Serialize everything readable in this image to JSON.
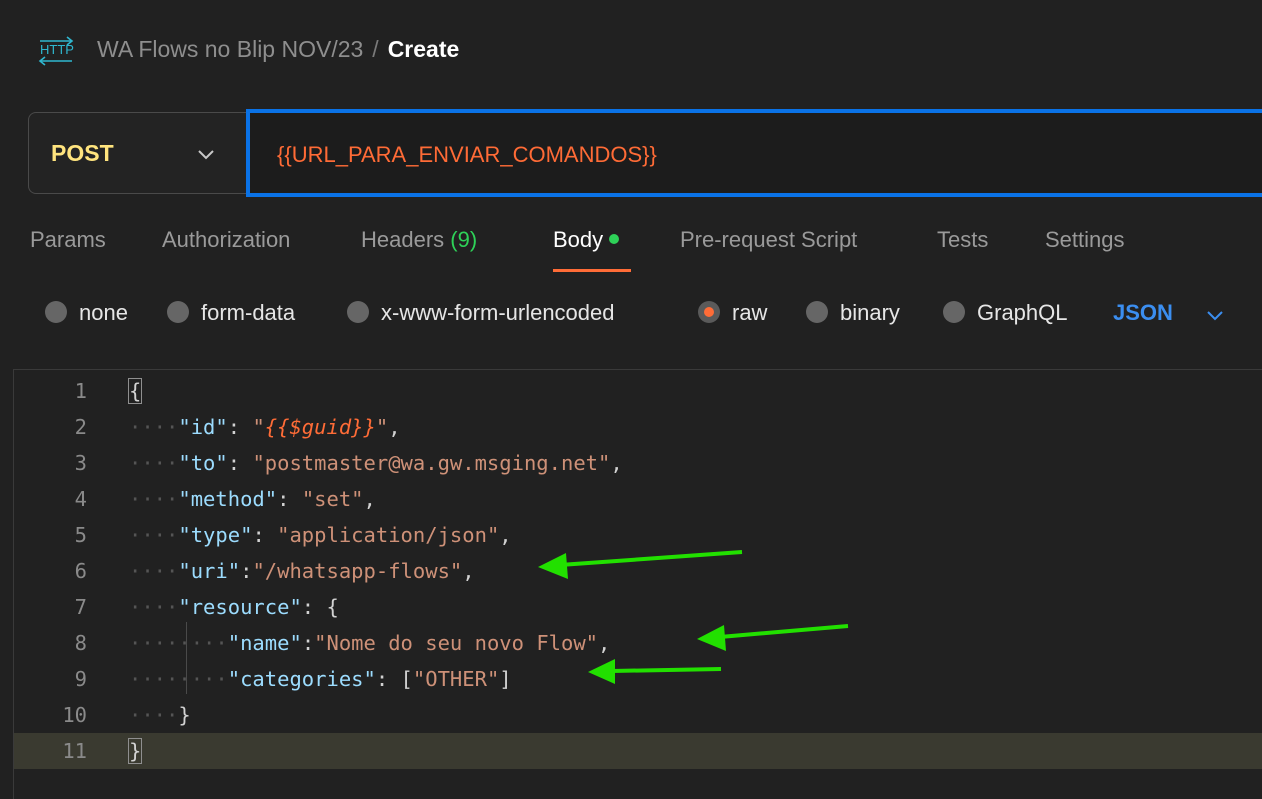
{
  "header": {
    "icon": "http-icon",
    "breadcrumb_parent": "WA Flows no Blip NOV/23",
    "breadcrumb_separator": "/",
    "breadcrumb_current": "Create"
  },
  "request": {
    "method": "POST",
    "url": "{{URL_PARA_ENVIAR_COMANDOS}}"
  },
  "tabs": [
    {
      "label": "Params"
    },
    {
      "label": "Authorization"
    },
    {
      "label": "Headers",
      "count": "(9)"
    },
    {
      "label": "Body",
      "active": true
    },
    {
      "label": "Pre-request Script"
    },
    {
      "label": "Tests"
    },
    {
      "label": "Settings"
    }
  ],
  "body_types": {
    "options": [
      "none",
      "form-data",
      "x-www-form-urlencoded",
      "raw",
      "binary",
      "GraphQL"
    ],
    "selected": "raw",
    "format": "JSON"
  },
  "editor": {
    "line_numbers": [
      "1",
      "2",
      "3",
      "4",
      "5",
      "6",
      "7",
      "8",
      "9",
      "10",
      "11"
    ],
    "lines": [
      {
        "indent": "",
        "tokens": [
          {
            "t": "{",
            "c": "punct"
          }
        ]
      },
      {
        "indent": "····",
        "tokens": [
          {
            "t": "\"id\"",
            "c": "key"
          },
          {
            "t": ": ",
            "c": "punct"
          },
          {
            "t": "\"",
            "c": "str"
          },
          {
            "t": "{{$guid}}",
            "c": "var"
          },
          {
            "t": "\"",
            "c": "str"
          },
          {
            "t": ",",
            "c": "punct"
          }
        ]
      },
      {
        "indent": "····",
        "tokens": [
          {
            "t": "\"to\"",
            "c": "key"
          },
          {
            "t": ": ",
            "c": "punct"
          },
          {
            "t": "\"postmaster@wa.gw.msging.net\"",
            "c": "str"
          },
          {
            "t": ",",
            "c": "punct"
          }
        ]
      },
      {
        "indent": "····",
        "tokens": [
          {
            "t": "\"method\"",
            "c": "key"
          },
          {
            "t": ": ",
            "c": "punct"
          },
          {
            "t": "\"set\"",
            "c": "str"
          },
          {
            "t": ",",
            "c": "punct"
          }
        ]
      },
      {
        "indent": "····",
        "tokens": [
          {
            "t": "\"type\"",
            "c": "key"
          },
          {
            "t": ": ",
            "c": "punct"
          },
          {
            "t": "\"application/json\"",
            "c": "str"
          },
          {
            "t": ",",
            "c": "punct"
          }
        ]
      },
      {
        "indent": "····",
        "tokens": [
          {
            "t": "\"uri\"",
            "c": "key"
          },
          {
            "t": ":",
            "c": "punct"
          },
          {
            "t": "\"/whatsapp-flows\"",
            "c": "str"
          },
          {
            "t": ",",
            "c": "punct"
          }
        ]
      },
      {
        "indent": "····",
        "tokens": [
          {
            "t": "\"resource\"",
            "c": "key"
          },
          {
            "t": ": {",
            "c": "punct"
          }
        ]
      },
      {
        "indent": "········",
        "tokens": [
          {
            "t": "\"name\"",
            "c": "key"
          },
          {
            "t": ":",
            "c": "punct"
          },
          {
            "t": "\"Nome do seu novo Flow\"",
            "c": "str"
          },
          {
            "t": ",",
            "c": "punct"
          }
        ]
      },
      {
        "indent": "········",
        "tokens": [
          {
            "t": "\"categories\"",
            "c": "key"
          },
          {
            "t": ": [",
            "c": "punct"
          },
          {
            "t": "\"OTHER\"",
            "c": "str"
          },
          {
            "t": "]",
            "c": "punct"
          }
        ]
      },
      {
        "indent": "····",
        "tokens": [
          {
            "t": "}",
            "c": "punct"
          }
        ]
      },
      {
        "indent": "",
        "tokens": [
          {
            "t": "}",
            "c": "punct"
          }
        ]
      }
    ],
    "current_line": "11"
  },
  "colors": {
    "accent": "#ff6c37",
    "focus_border": "#0a72e6",
    "annotation_arrow": "#22e000",
    "method": "#ffe47e",
    "url": "#ff6b36"
  }
}
